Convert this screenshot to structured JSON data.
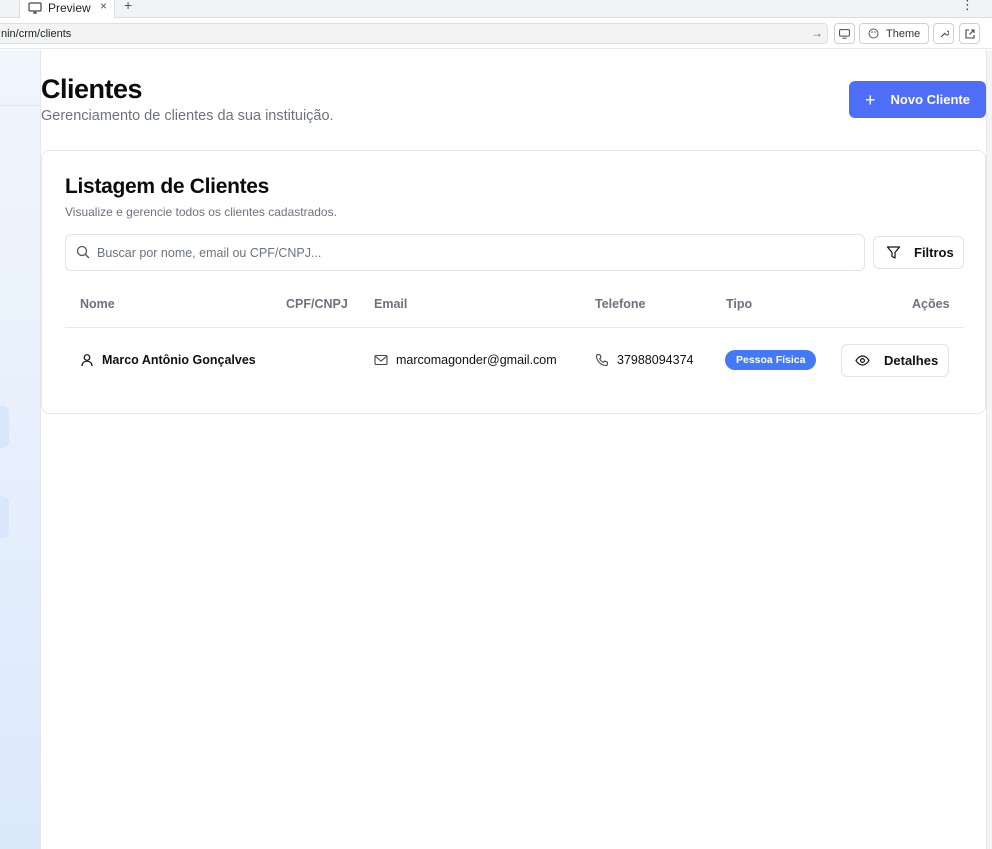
{
  "browser": {
    "tab_title": "Preview",
    "tab_close": "×",
    "new_tab": "+",
    "menu": "⋮",
    "url": "nin/crm/clients",
    "theme_label": "Theme"
  },
  "page": {
    "title": "Clientes",
    "subtitle": "Gerenciamento de clientes da sua instituição.",
    "new_button_label": "Novo Cliente"
  },
  "card": {
    "title": "Listagem de Clientes",
    "subtitle": "Visualize e gerencie todos os clientes cadastrados.",
    "search_placeholder": "Buscar por nome, email ou CPF/CNPJ...",
    "filters_label": "Filtros"
  },
  "table": {
    "columns": [
      "Nome",
      "CPF/CNPJ",
      "Email",
      "Telefone",
      "Tipo",
      "Ações"
    ],
    "rows": [
      {
        "name": "Marco Antônio Gonçalves",
        "document": "",
        "email": "marcomagonder@gmail.com",
        "phone": "37988094374",
        "type": "Pessoa Física",
        "action": "Detalhes"
      }
    ]
  },
  "colors": {
    "primary": "#4f6ef7",
    "badge": "#4279f5",
    "muted_text": "#6b7280"
  }
}
